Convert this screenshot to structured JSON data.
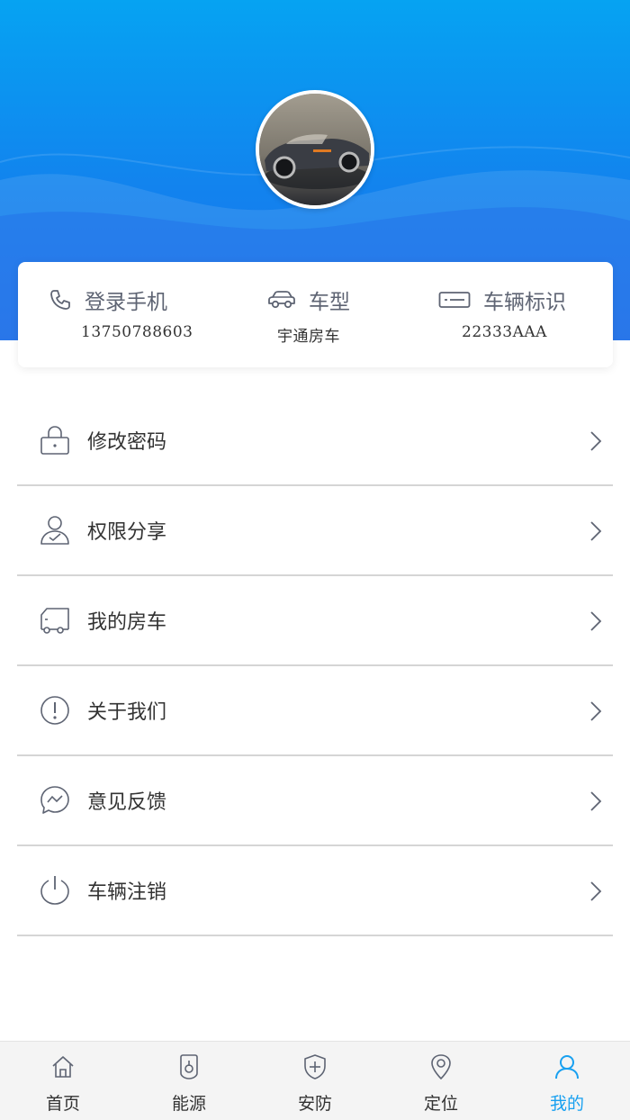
{
  "profile": {
    "avatar_icon": "car-avatar-image"
  },
  "info_card": {
    "phone": {
      "title": "登录手机",
      "value": "13750788603",
      "icon": "phone-icon"
    },
    "model": {
      "title": "车型",
      "value": "宇通房车",
      "icon": "car-icon"
    },
    "plate": {
      "title": "车辆标识",
      "value": "22333AAA",
      "icon": "card-icon"
    }
  },
  "menu": {
    "items": [
      {
        "label": "修改密码",
        "icon": "lock-icon"
      },
      {
        "label": "权限分享",
        "icon": "user-share-icon"
      },
      {
        "label": "我的房车",
        "icon": "rv-icon"
      },
      {
        "label": "关于我们",
        "icon": "info-icon"
      },
      {
        "label": "意见反馈",
        "icon": "message-icon"
      },
      {
        "label": "车辆注销",
        "icon": "power-icon"
      }
    ]
  },
  "tabbar": {
    "tabs": [
      {
        "label": "首页",
        "icon": "home-icon"
      },
      {
        "label": "能源",
        "icon": "energy-icon"
      },
      {
        "label": "安防",
        "icon": "shield-icon"
      },
      {
        "label": "定位",
        "icon": "location-icon"
      },
      {
        "label": "我的",
        "icon": "profile-icon",
        "active": true
      }
    ]
  },
  "colors": {
    "header_top": "#06a3f2",
    "header_bottom": "#1a72ea",
    "active_tab": "#18a0f0",
    "icon_stroke": "#5e6473"
  }
}
